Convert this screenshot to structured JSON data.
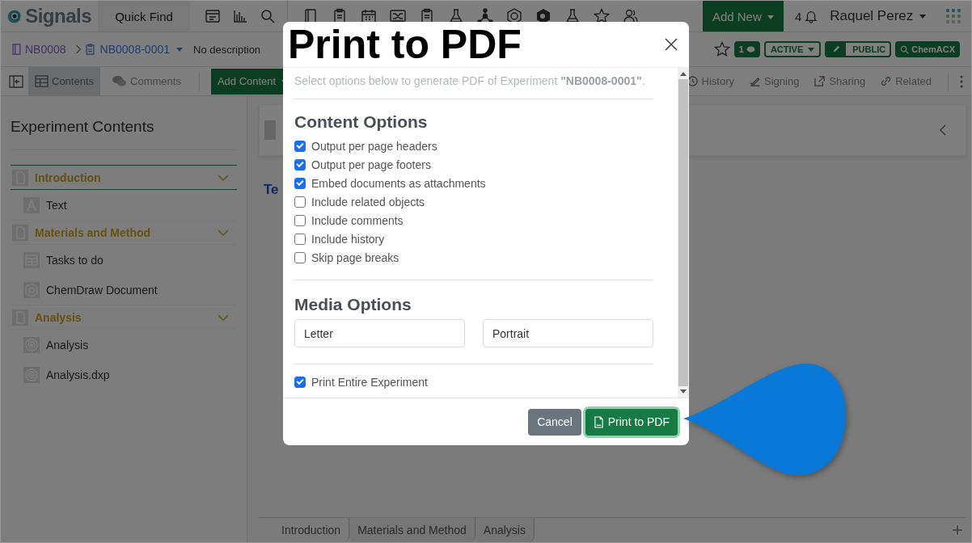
{
  "app": {
    "logo": "Signals",
    "quick_find": "Quick Find",
    "add_new": "Add New",
    "notifications": "4",
    "user": "Raquel Perez"
  },
  "breadcrumb": {
    "notebook": "NB0008",
    "experiment": "NB0008-0001",
    "description": "No description"
  },
  "badges": {
    "comments": "1",
    "status": "ACTIVE",
    "visibility": "PUBLIC",
    "search": "ChemACX"
  },
  "toolbar": {
    "tabs": [
      {
        "label": "Contents",
        "selected": true
      },
      {
        "label": "Comments",
        "selected": false
      }
    ],
    "add_content": "Add Content",
    "actions": [
      {
        "label": "History",
        "kind": "history"
      },
      {
        "label": "Signing",
        "kind": "signing"
      },
      {
        "label": "Sharing",
        "kind": "sharing"
      },
      {
        "label": "Related",
        "kind": "related"
      }
    ]
  },
  "sidebar": {
    "title": "Experiment Contents",
    "sections": [
      {
        "label": "Introduction",
        "selected": true,
        "children": [
          {
            "label": "Text",
            "kind": "text"
          }
        ]
      },
      {
        "label": "Materials and Method",
        "selected": false,
        "children": [
          {
            "label": "Tasks to do",
            "kind": "table"
          },
          {
            "label": "ChemDraw Document",
            "kind": "chemdraw"
          }
        ]
      },
      {
        "label": "Analysis",
        "selected": false,
        "children": [
          {
            "label": "Analysis",
            "kind": "analysis"
          },
          {
            "label": "Analysis.dxp",
            "kind": "analysis"
          }
        ]
      }
    ]
  },
  "content": {
    "heading": "Te"
  },
  "bottom_tabs": [
    {
      "label": "Introduction",
      "selected": true
    },
    {
      "label": "Materials and Method",
      "selected": false
    },
    {
      "label": "Analysis",
      "selected": false
    }
  ],
  "dialog": {
    "title": "Print to PDF",
    "intro": "Select options below to generate PDF of Experiment **\"NB0008-0001\"**.",
    "content_heading": "Content Options",
    "options": [
      {
        "label": "Output per page headers",
        "checked": true
      },
      {
        "label": "Output per page footers",
        "checked": true
      },
      {
        "label": "Embed documents as attachments",
        "checked": true
      },
      {
        "label": "Include related objects",
        "checked": false
      },
      {
        "label": "Include comments",
        "checked": false
      },
      {
        "label": "Include history",
        "checked": false
      },
      {
        "label": "Skip page breaks",
        "checked": false
      }
    ],
    "media_heading": "Media Options",
    "fields": [
      {
        "value": "Letter"
      },
      {
        "value": "Portrait"
      }
    ],
    "print_entire": {
      "label": "Print Entire Experiment",
      "checked": true
    },
    "buttons": {
      "cancel": "Cancel",
      "print": "Print to PDF"
    }
  }
}
